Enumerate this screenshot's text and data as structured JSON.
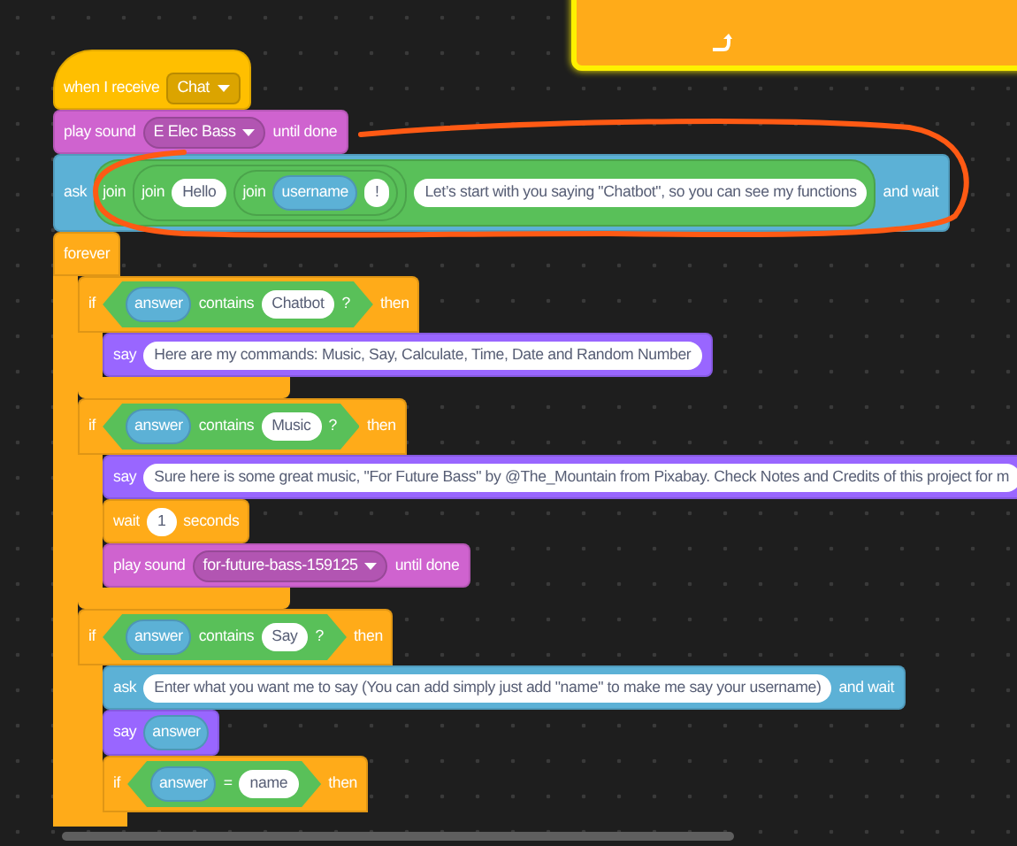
{
  "script": [
    {
      "kind": "hat",
      "color": "#ffbf00",
      "parts": [
        {
          "kind": "label",
          "text": "when I receive"
        },
        {
          "kind": "dropdown",
          "text": "Chat"
        }
      ]
    },
    {
      "kind": "stack",
      "color": "#cf63cf",
      "parts": [
        {
          "kind": "label",
          "text": "play sound"
        },
        {
          "kind": "dropdown",
          "text": "E Elec Bass"
        },
        {
          "kind": "label",
          "text": "until done"
        }
      ]
    },
    {
      "kind": "stack",
      "color": "#5cb1d6",
      "parts": [
        {
          "kind": "label",
          "text": "ask"
        },
        {
          "kind": "reporter",
          "color": "#59c059",
          "parts": [
            {
              "kind": "label",
              "text": "join"
            },
            {
              "kind": "reporter",
              "color": "#59c059",
              "parts": [
                {
                  "kind": "label",
                  "text": "join"
                },
                {
                  "kind": "input",
                  "text": "Hello"
                },
                {
                  "kind": "reporter",
                  "color": "#59c059",
                  "parts": [
                    {
                      "kind": "label",
                      "text": "join"
                    },
                    {
                      "kind": "reporter",
                      "color": "#5cb1d6",
                      "parts": [
                        {
                          "kind": "label",
                          "text": "username"
                        }
                      ]
                    },
                    {
                      "kind": "input",
                      "text": "!"
                    }
                  ]
                }
              ]
            },
            {
              "kind": "input",
              "text": "Let’s start with you saying \"Chatbot\", so you can see my functions"
            }
          ]
        },
        {
          "kind": "label",
          "text": "and wait"
        }
      ]
    },
    {
      "kind": "c",
      "color": "#ffab19",
      "closed": false,
      "parts": [
        {
          "kind": "label",
          "text": "forever"
        }
      ],
      "children": [
        {
          "kind": "c",
          "color": "#ffab19",
          "closed": true,
          "parts": [
            {
              "kind": "label",
              "text": "if"
            },
            {
              "kind": "boolean",
              "color": "#59c059",
              "parts": [
                {
                  "kind": "reporter",
                  "color": "#5cb1d6",
                  "parts": [
                    {
                      "kind": "label",
                      "text": "answer"
                    }
                  ]
                },
                {
                  "kind": "label",
                  "text": "contains"
                },
                {
                  "kind": "input",
                  "text": "Chatbot"
                },
                {
                  "kind": "label",
                  "text": "?"
                }
              ]
            },
            {
              "kind": "label",
              "text": "then"
            }
          ],
          "children": [
            {
              "kind": "stack",
              "color": "#9966ff",
              "parts": [
                {
                  "kind": "label",
                  "text": "say"
                },
                {
                  "kind": "input",
                  "text": "Here are my commands: Music, Say, Calculate, Time, Date and Random Number"
                }
              ]
            }
          ]
        },
        {
          "kind": "c",
          "color": "#ffab19",
          "closed": true,
          "parts": [
            {
              "kind": "label",
              "text": "if"
            },
            {
              "kind": "boolean",
              "color": "#59c059",
              "parts": [
                {
                  "kind": "reporter",
                  "color": "#5cb1d6",
                  "parts": [
                    {
                      "kind": "label",
                      "text": "answer"
                    }
                  ]
                },
                {
                  "kind": "label",
                  "text": "contains"
                },
                {
                  "kind": "input",
                  "text": "Music"
                },
                {
                  "kind": "label",
                  "text": "?"
                }
              ]
            },
            {
              "kind": "label",
              "text": "then"
            }
          ],
          "children": [
            {
              "kind": "stack",
              "color": "#9966ff",
              "parts": [
                {
                  "kind": "label",
                  "text": "say"
                },
                {
                  "kind": "input",
                  "text": "Sure here is some great music, \"For Future Bass\" by @The_Mountain from Pixabay. Check Notes and Credits of this project for m"
                }
              ]
            },
            {
              "kind": "stack",
              "color": "#ffab19",
              "parts": [
                {
                  "kind": "label",
                  "text": "wait"
                },
                {
                  "kind": "input",
                  "text": "1"
                },
                {
                  "kind": "label",
                  "text": "seconds"
                }
              ]
            },
            {
              "kind": "stack",
              "color": "#cf63cf",
              "parts": [
                {
                  "kind": "label",
                  "text": "play sound"
                },
                {
                  "kind": "dropdown",
                  "text": "for-future-bass-159125"
                },
                {
                  "kind": "label",
                  "text": "until done"
                }
              ]
            }
          ]
        },
        {
          "kind": "c",
          "color": "#ffab19",
          "closed": false,
          "parts": [
            {
              "kind": "label",
              "text": "if"
            },
            {
              "kind": "boolean",
              "color": "#59c059",
              "parts": [
                {
                  "kind": "reporter",
                  "color": "#5cb1d6",
                  "parts": [
                    {
                      "kind": "label",
                      "text": "answer"
                    }
                  ]
                },
                {
                  "kind": "label",
                  "text": "contains"
                },
                {
                  "kind": "input",
                  "text": "Say"
                },
                {
                  "kind": "label",
                  "text": "?"
                }
              ]
            },
            {
              "kind": "label",
              "text": "then"
            }
          ],
          "children": [
            {
              "kind": "stack",
              "color": "#5cb1d6",
              "parts": [
                {
                  "kind": "label",
                  "text": "ask"
                },
                {
                  "kind": "input",
                  "text": "Enter what you want me to say (You can add simply just add \"name\" to make me say your username)"
                },
                {
                  "kind": "label",
                  "text": "and wait"
                }
              ]
            },
            {
              "kind": "stack",
              "color": "#9966ff",
              "parts": [
                {
                  "kind": "label",
                  "text": "say"
                },
                {
                  "kind": "reporter",
                  "color": "#5cb1d6",
                  "parts": [
                    {
                      "kind": "label",
                      "text": "answer"
                    }
                  ]
                }
              ]
            },
            {
              "kind": "c",
              "color": "#ffab19",
              "closed": false,
              "parts": [
                {
                  "kind": "label",
                  "text": "if"
                },
                {
                  "kind": "boolean",
                  "color": "#59c059",
                  "parts": [
                    {
                      "kind": "reporter",
                      "color": "#5cb1d6",
                      "parts": [
                        {
                          "kind": "label",
                          "text": "answer"
                        }
                      ]
                    },
                    {
                      "kind": "label",
                      "text": "="
                    },
                    {
                      "kind": "input",
                      "text": "name"
                    }
                  ]
                },
                {
                  "kind": "label",
                  "text": "then"
                }
              ]
            }
          ]
        }
      ]
    }
  ]
}
